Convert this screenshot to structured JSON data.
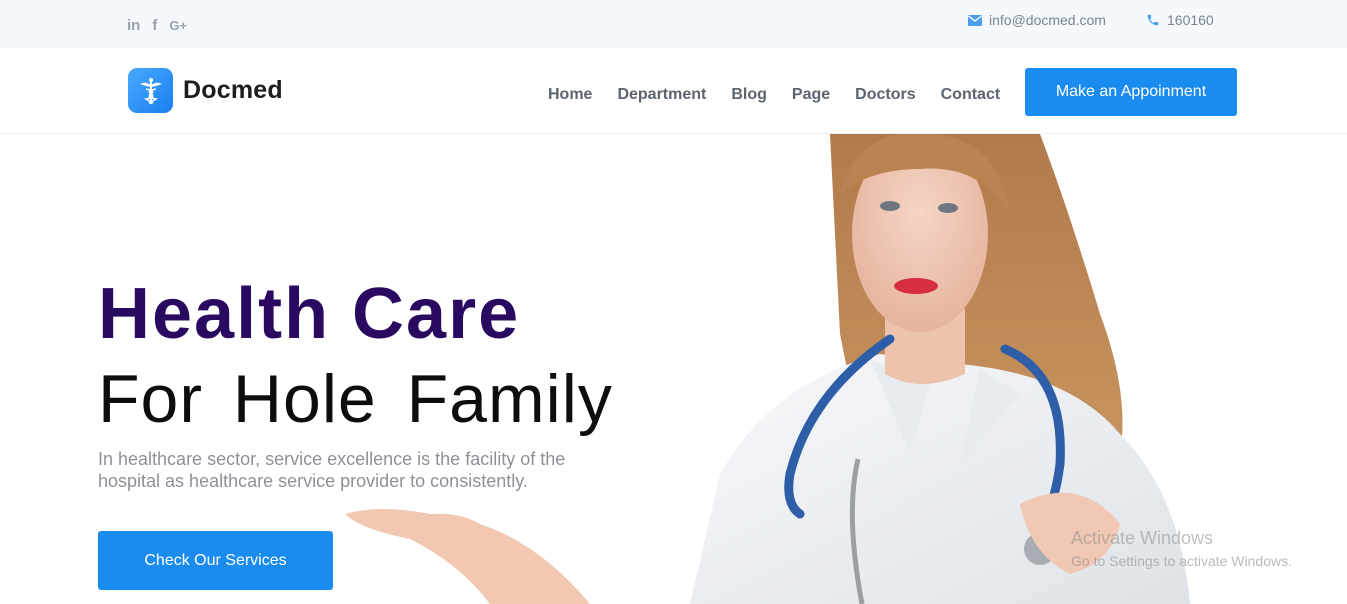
{
  "topbar": {
    "social": [
      {
        "icon": "linkedin-icon",
        "glyph": "in"
      },
      {
        "icon": "facebook-icon",
        "glyph": "f"
      },
      {
        "icon": "google-plus-icon",
        "glyph": "G+"
      }
    ],
    "email": "info@docmed.com",
    "phone": "160160"
  },
  "header": {
    "brand": "Docmed",
    "nav": [
      "Home",
      "Department",
      "Blog",
      "Page",
      "Doctors",
      "Contact"
    ],
    "cta_label": "Make an Appoinment"
  },
  "hero": {
    "title_line_1": "Health Care",
    "title_line_2": "For Hole Family",
    "description": "In healthcare sector, service excellence is the facility of the hospital as healthcare service provider to consistently.",
    "cta_label": "Check Our Services"
  },
  "watermark": {
    "line_1": "Activate Windows",
    "line_2": "Go to Settings to activate Windows."
  },
  "colors": {
    "accent": "#1a8cf0",
    "title_purple": "#2a0a60",
    "topbar_bg": "#f4f9fd"
  }
}
